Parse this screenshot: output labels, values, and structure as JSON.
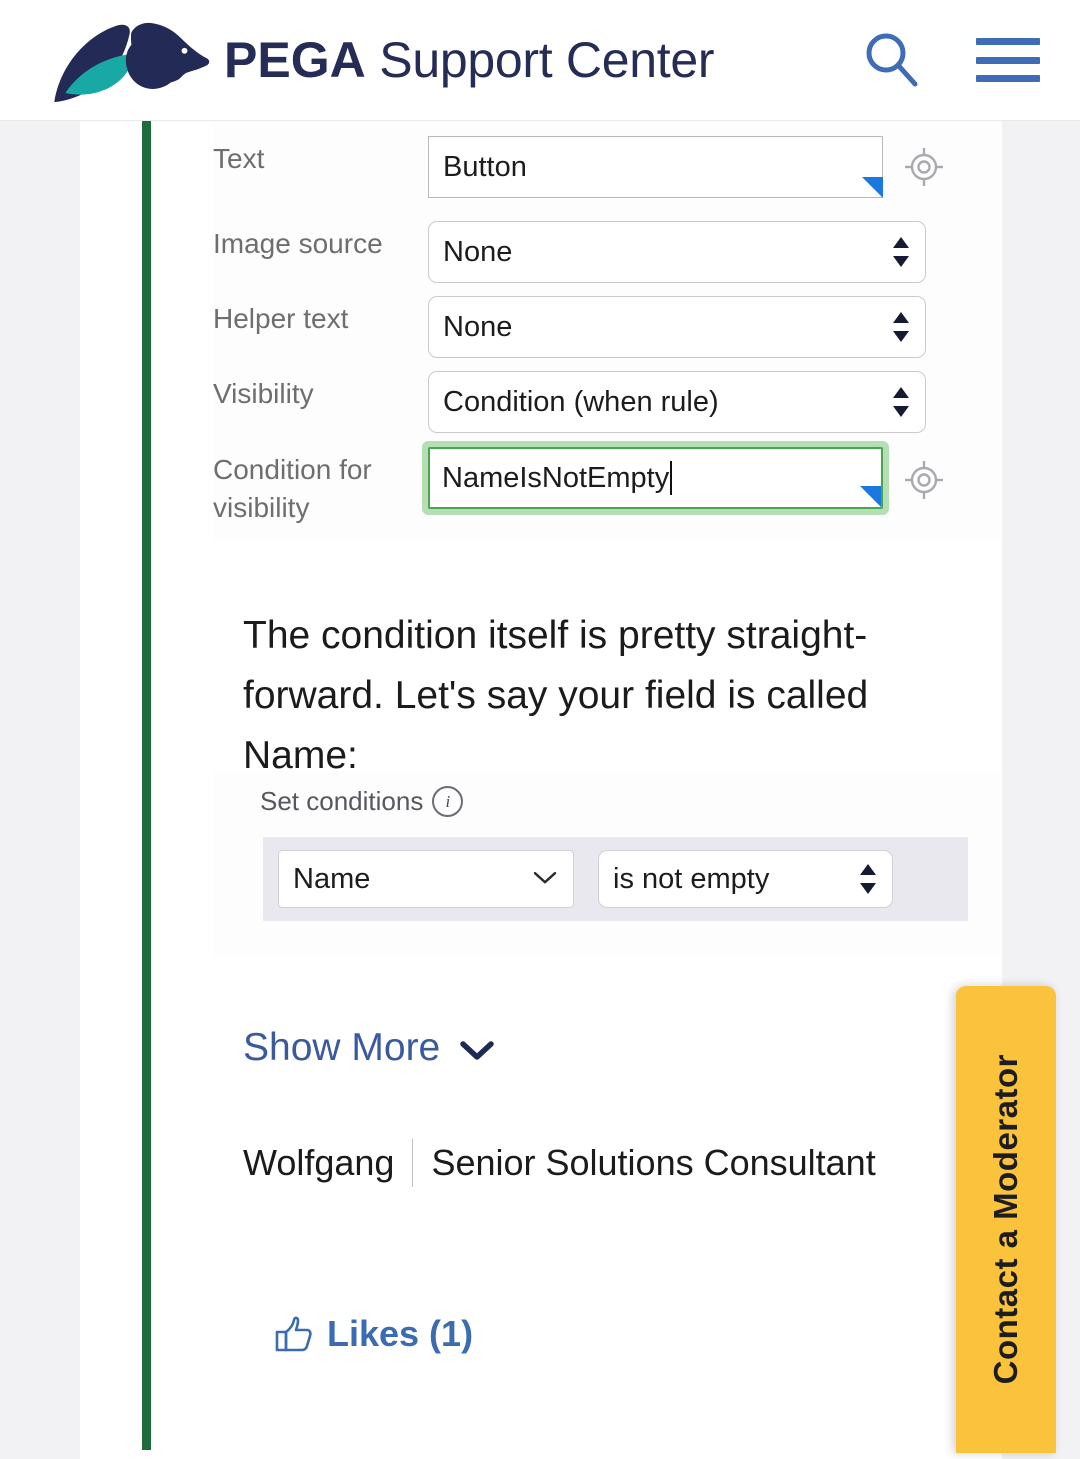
{
  "header": {
    "brand_bold": "PEGA",
    "brand_rest": " Support Center",
    "search_icon": "search-icon",
    "menu_icon": "hamburger-menu-icon",
    "logo_icon": "pega-horse-logo",
    "brand_color": "#252c56",
    "icon_color": "#3e6cb5"
  },
  "post": {
    "thread_bar_color": "#1e6b3b",
    "screenshot_one": {
      "title": "Button property panel",
      "fields": [
        {
          "label": "Text",
          "type": "text",
          "value": "Button",
          "has_corner_flag": true,
          "has_crosshair": true
        },
        {
          "label": "Image source",
          "type": "select",
          "value": "None",
          "has_corner_flag": false,
          "has_crosshair": false
        },
        {
          "label": "Helper text",
          "type": "select",
          "value": "None",
          "has_corner_flag": false,
          "has_crosshair": false
        },
        {
          "label": "Visibility",
          "type": "select",
          "value": "Condition (when rule)",
          "has_corner_flag": false,
          "has_crosshair": false
        },
        {
          "label": "Condition for visibility",
          "type": "text-focused",
          "value": "NameIsNotEmpty",
          "has_corner_flag": true,
          "has_crosshair": true,
          "focus_color": "#4aa351"
        }
      ]
    },
    "paragraph": "The condition itself is pretty straight-forward. Let's say your field is called Name:",
    "screenshot_two": {
      "section_label": "Set conditions",
      "info_icon_char": "i",
      "condition_row": {
        "field_value": "Name",
        "field_icon": "chevron-down-icon",
        "operator_value": "is not empty",
        "operator_icon": "spinner-arrows-icon"
      }
    },
    "show_more_label": "Show More",
    "show_more_icon": "chevron-down-icon",
    "author_name": "Wolfgang",
    "author_role": "Senior Solutions Consultant",
    "likes_label": "Likes (1)",
    "likes_icon": "thumbs-up-icon",
    "link_color": "#3b5a9e"
  },
  "moderator_tab": {
    "label": "Contact a Moderator",
    "background": "#fbc33c"
  }
}
